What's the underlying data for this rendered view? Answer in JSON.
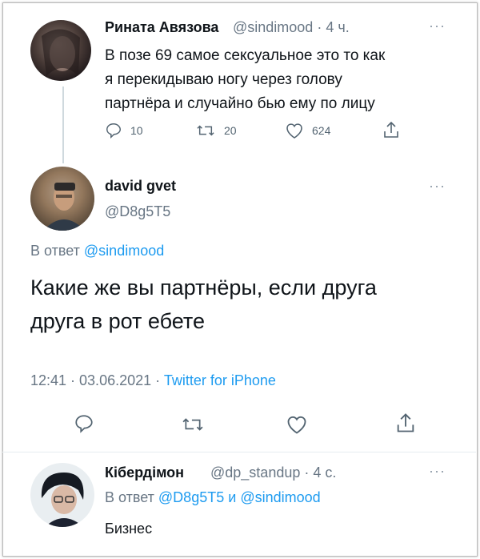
{
  "tweet1": {
    "name": "Рината Авязова",
    "handle_time": "@sindimood · 4 ч.",
    "more": "···",
    "text_lines": [
      "В позе 69 самое сексуальное это то как",
      "я перекидываю ногу через голову",
      "партнёра и случайно бью ему по лицу"
    ],
    "replies": "10",
    "retweets": "20",
    "likes": "624"
  },
  "tweet2": {
    "name": "david gvet",
    "handle": "@D8g5T5",
    "more": "···",
    "reply_prefix": "В ответ",
    "reply_to": "@sindimood",
    "text_lines": [
      "Какие же вы партнёры, если друга",
      "друга в рот ебете"
    ],
    "time_date": "12:41 · 03.06.2021 ·",
    "source": "Twitter for iPhone"
  },
  "tweet3": {
    "name": "Кібердімон",
    "handle_time": "@dp_standup · 4 с.",
    "more": "···",
    "reply_prefix": "В ответ",
    "reply_to1": "@D8g5T5",
    "reply_and": "и",
    "reply_to2": "@sindimood",
    "text": "Бизнес"
  },
  "colors": {
    "link": "#1d9bf0",
    "muted": "#687684",
    "text": "#0f1419"
  }
}
